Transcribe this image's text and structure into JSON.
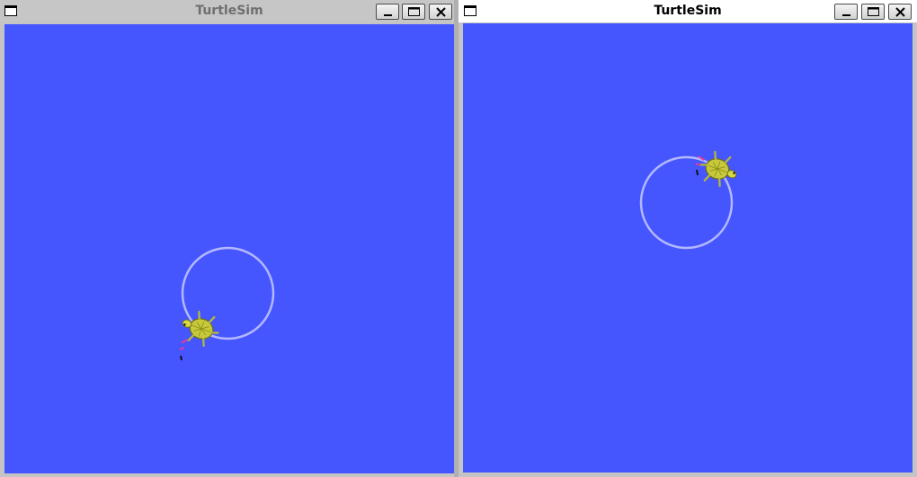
{
  "windows": [
    {
      "title": "TurtleSim",
      "focused": false,
      "background_color": "#4556ff",
      "trail_color": "#b3b8ff",
      "buttons": {
        "minimize": "minimize-icon",
        "maximize": "maximize-icon",
        "close": "close-icon"
      },
      "turtle": {
        "icon": "turtle-icon"
      }
    },
    {
      "title": "TurtleSim",
      "focused": true,
      "background_color": "#4556ff",
      "trail_color": "#b3b8ff",
      "buttons": {
        "minimize": "minimize-icon",
        "maximize": "maximize-icon",
        "close": "close-icon"
      },
      "turtle": {
        "icon": "turtle-icon"
      }
    }
  ]
}
